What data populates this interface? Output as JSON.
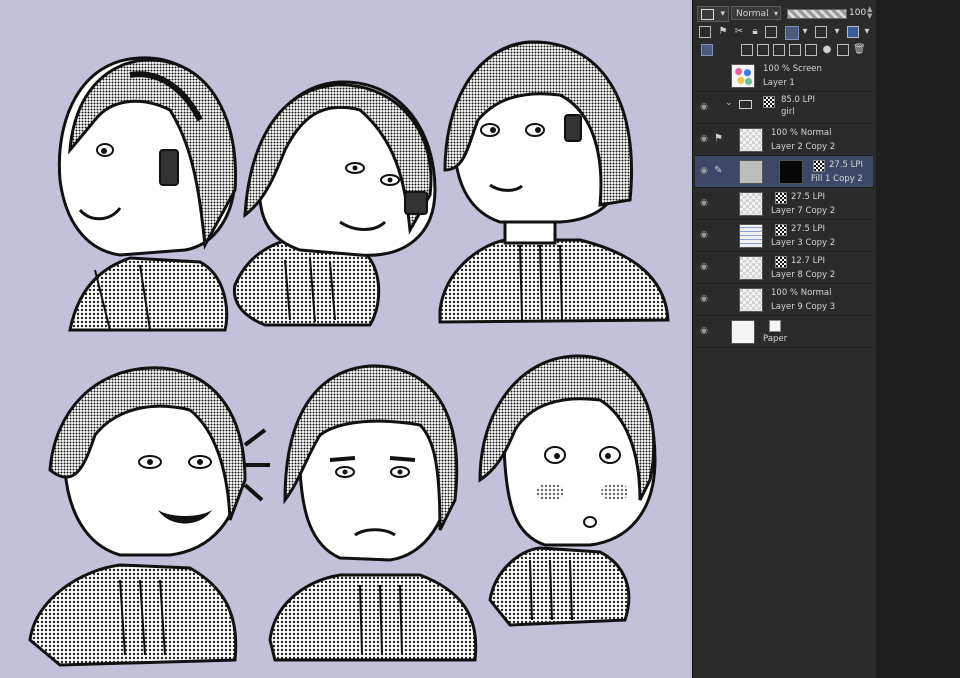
{
  "toolbar": {
    "blend_mode": "Normal",
    "opacity": "100",
    "colors": {
      "panel_bg": "#2b2b2b",
      "canvas_bg": "#c2c1da",
      "active_row": "#3c4866"
    }
  },
  "layers": [
    {
      "top": "100 % Screen",
      "name": "Layer 1",
      "thumb": "colorful"
    },
    {
      "top": "85.0 LPI",
      "name": "girl",
      "type": "folder"
    },
    {
      "top": "100 % Normal",
      "name": "Layer 2 Copy 2",
      "thumb": "checker"
    },
    {
      "top": "27.5 LPI",
      "name": "Fill 1 Copy 2",
      "thumb": "grey",
      "mask": "black",
      "active": true
    },
    {
      "top": "27.5 LPI",
      "name": "Layer 7 Copy 2",
      "thumb": "checker"
    },
    {
      "top": "27.5 LPI",
      "name": "Layer 3 Copy 2",
      "thumb": "lined"
    },
    {
      "top": "12.7 LPI",
      "name": "Layer 8 Copy 2",
      "thumb": "checker"
    },
    {
      "top": "100 % Normal",
      "name": "Layer 9 Copy 3",
      "thumb": "checker"
    },
    {
      "top": "",
      "name": "Paper",
      "thumb": "white"
    }
  ],
  "icons": [
    "eye-icon",
    "folder-icon",
    "pen-icon",
    "lock-icon",
    "trash-icon",
    "new-layer-icon"
  ]
}
